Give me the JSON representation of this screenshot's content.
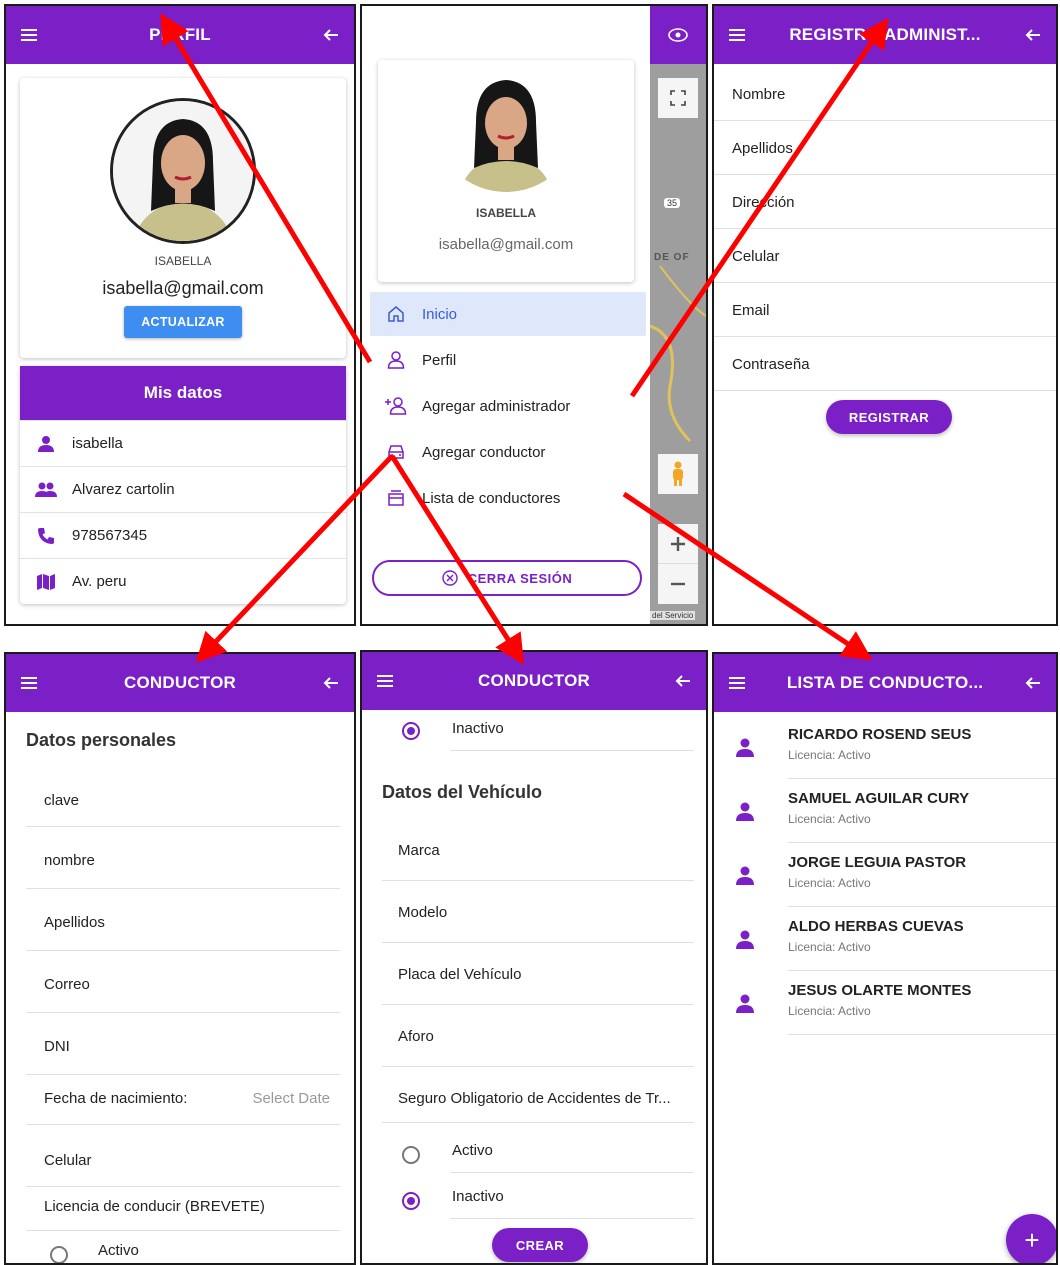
{
  "colors": {
    "primary": "#7b1fc6",
    "accent_blue": "#3d8ef0",
    "arrow": "#ff0000"
  },
  "perfil": {
    "title": "PERFIL",
    "name": "ISABELLA",
    "email": "isabella@gmail.com",
    "update_label": "ACTUALIZAR",
    "mis_datos_title": "Mis datos",
    "rows": [
      {
        "icon": "person-icon",
        "text": "isabella"
      },
      {
        "icon": "people-icon",
        "text": "Alvarez cartolin"
      },
      {
        "icon": "phone-icon",
        "text": "978567345"
      },
      {
        "icon": "map-icon",
        "text": "Av. peru"
      }
    ]
  },
  "drawer": {
    "name": "ISABELLA",
    "email": "isabella@gmail.com",
    "items": [
      {
        "icon": "home-icon",
        "label": "Inicio"
      },
      {
        "icon": "person-outline-icon",
        "label": "Perfil"
      },
      {
        "icon": "person-add-icon",
        "label": "Agregar administrador"
      },
      {
        "icon": "car-icon",
        "label": "Agregar conductor"
      },
      {
        "icon": "file-tray-icon",
        "label": "Lista de conductores"
      }
    ],
    "logout_label": "CERRA SESIÓN",
    "map_text": {
      "road_label": "35",
      "place_label": "DE OF",
      "footer": "del Servicio"
    }
  },
  "registro": {
    "title": "REGISTRO ADMINIST...",
    "fields": [
      "Nombre",
      "Apellidos",
      "Dirección",
      "Celular",
      "Email",
      "Contraseña"
    ],
    "submit_label": "REGISTRAR"
  },
  "conductor1": {
    "title": "CONDUCTOR",
    "section": "Datos personales",
    "fields": [
      "clave",
      "nombre",
      "Apellidos",
      "Correo",
      "DNI"
    ],
    "date_label": "Fecha de nacimiento:",
    "date_placeholder": "Select Date",
    "celular": "Celular",
    "licencia": "Licencia de conducir (BREVETE)",
    "radio_activo": "Activo"
  },
  "conductor2": {
    "title": "CONDUCTOR",
    "radio_top": "Inactivo",
    "section": "Datos del Vehículo",
    "fields": [
      "Marca",
      "Modelo",
      "Placa del Vehículo",
      "Aforo",
      "Seguro Obligatorio de Accidentes de Tr..."
    ],
    "radio_activo": "Activo",
    "radio_inactivo": "Inactivo",
    "submit_label": "CREAR"
  },
  "lista": {
    "title": "LISTA DE CONDUCTO...",
    "drivers": [
      {
        "name": "RICARDO  ROSEND SEUS",
        "sub": "Licencia:  Activo"
      },
      {
        "name": "SAMUEL  AGUILAR CURY",
        "sub": "Licencia:  Activo"
      },
      {
        "name": "JORGE  LEGUIA PASTOR",
        "sub": "Licencia:  Activo"
      },
      {
        "name": "ALDO  HERBAS CUEVAS",
        "sub": "Licencia:  Activo"
      },
      {
        "name": "JESUS  OLARTE MONTES",
        "sub": "Licencia:  Activo"
      }
    ],
    "fab_label": "+"
  }
}
